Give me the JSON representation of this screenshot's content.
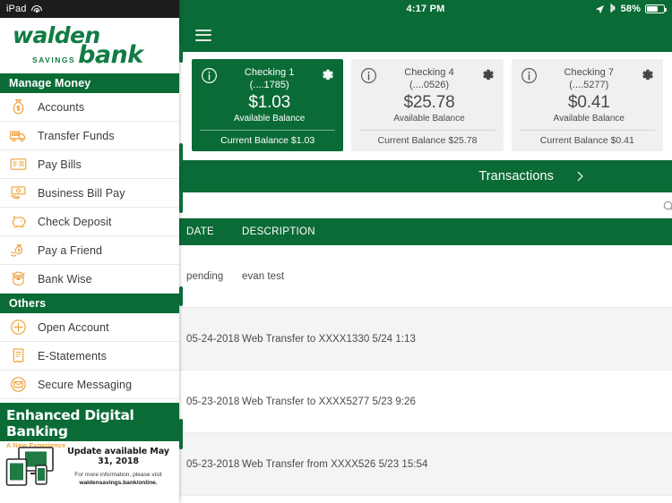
{
  "status_bar": {
    "device_label": "iPad",
    "wifi_icon": "wifi-icon",
    "time": "4:17 PM",
    "location_icon": "location-arrow-icon",
    "bluetooth_icon": "bluetooth-icon",
    "battery_pct": "58%",
    "battery_icon": "battery-icon"
  },
  "brand": {
    "word1": "walden",
    "word2": "SAVINGS",
    "word3": "bank"
  },
  "navbar": {
    "menu_icon": "hamburger-menu-icon"
  },
  "sidebar": {
    "sections": [
      {
        "title": "Manage Money",
        "items": [
          {
            "label": "Accounts",
            "icon": "money-bag-icon"
          },
          {
            "label": "Transfer Funds",
            "icon": "armored-truck-icon"
          },
          {
            "label": "Pay Bills",
            "icon": "invoice-icon"
          },
          {
            "label": "Business Bill Pay",
            "icon": "hand-cash-icon"
          },
          {
            "label": "Check Deposit",
            "icon": "piggy-bank-icon"
          },
          {
            "label": "Pay a Friend",
            "icon": "hand-money-bag-icon"
          },
          {
            "label": "Bank Wise",
            "icon": "owl-icon"
          }
        ]
      },
      {
        "title": "Others",
        "items": [
          {
            "label": "Open Account",
            "icon": "plus-circle-icon"
          },
          {
            "label": "E-Statements",
            "icon": "statement-icon"
          },
          {
            "label": "Secure Messaging",
            "icon": "envelope-circle-icon"
          }
        ]
      }
    ],
    "promo": {
      "title": "Enhanced Digital Banking",
      "subtitle": "A New Experience",
      "devices_icon": "devices-illustration-icon",
      "headline": "Update available May 31, 2018",
      "body_prefix": "For more information, please visit",
      "url": "waldensavings.bank/online."
    }
  },
  "accounts": [
    {
      "name": "Checking 1",
      "mask": "(....1785)",
      "amount": "$1.03",
      "available_label": "Available Balance",
      "current_label": "Current Balance $1.03",
      "selected": true,
      "info_icon": "info-circle-icon",
      "gear_icon": "gear-icon"
    },
    {
      "name": "Checking 4",
      "mask": "(....0526)",
      "amount": "$25.78",
      "available_label": "Available Balance",
      "current_label": "Current Balance $25.78",
      "selected": false,
      "info_icon": "info-circle-icon",
      "gear_icon": "gear-icon"
    },
    {
      "name": "Checking 7",
      "mask": "(....5277)",
      "amount": "$0.41",
      "available_label": "Available Balance",
      "current_label": "Current Balance $0.41",
      "selected": false,
      "info_icon": "info-circle-icon",
      "gear_icon": "gear-icon"
    }
  ],
  "transactions_bar": {
    "label": "Transactions",
    "chevron_icon": "chevron-right-icon"
  },
  "search": {
    "icon": "search-icon"
  },
  "table": {
    "headers": {
      "date": "DATE",
      "description": "DESCRIPTION"
    },
    "rows": [
      {
        "date": "pending",
        "description": "evan test"
      },
      {
        "date": "05-24-2018",
        "description": "Web Transfer to XXXX1330 5/24 1:13"
      },
      {
        "date": "05-23-2018",
        "description": "Web Transfer to XXXX5277 5/23 9:26"
      },
      {
        "date": "05-23-2018",
        "description": "Web Transfer from XXXX526 5/23 15:54"
      }
    ]
  },
  "colors": {
    "brand_green": "#0b6b37",
    "logo_green": "#117c43",
    "accent_orange": "#f0a73c",
    "inactive_card": "#f0f0f0",
    "alt_row": "#f4f4f4"
  }
}
